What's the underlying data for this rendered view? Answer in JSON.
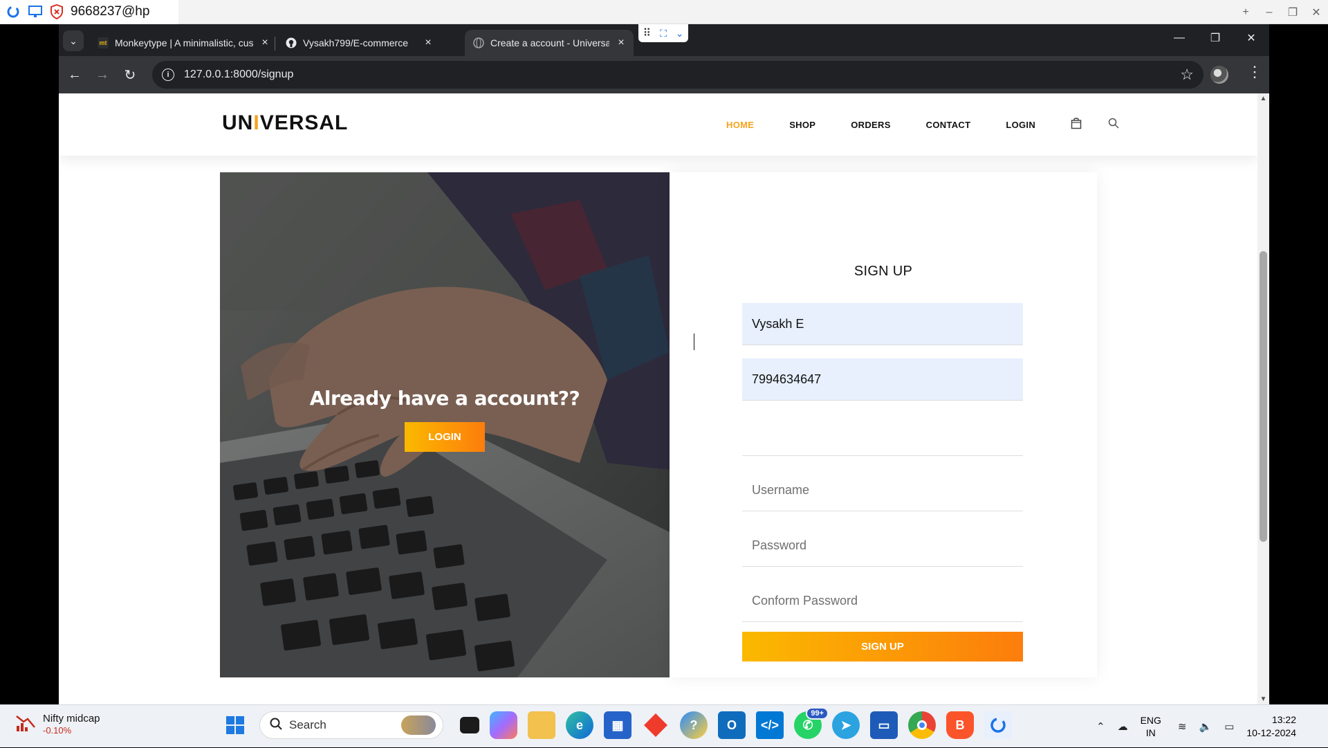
{
  "remote_bar": {
    "title": "9668237@hp"
  },
  "browser": {
    "tabs": [
      {
        "title": "Monkeytype | A minimalistic, customizable typing test",
        "favicon": "mt"
      },
      {
        "title": "Vysakh799/E-commerce",
        "favicon": "github-icon"
      },
      {
        "title": "Create a account - Universal",
        "favicon": "globe-icon"
      }
    ],
    "url": "127.0.0.1:8000/signup"
  },
  "site": {
    "logo": {
      "pre": "UN",
      "accent": "I",
      "post": "VERSAL"
    },
    "nav": [
      {
        "label": "HOME",
        "active": true
      },
      {
        "label": "SHOP",
        "active": false
      },
      {
        "label": "ORDERS",
        "active": false
      },
      {
        "label": "CONTACT",
        "active": false
      },
      {
        "label": "LOGIN",
        "active": false
      }
    ],
    "hero": {
      "heading": "Already have a account??",
      "login_button": "LOGIN"
    },
    "form": {
      "title": "SIGN UP",
      "name_value": "Vysakh E",
      "phone_value": "7994634647",
      "email_value": "",
      "username_placeholder": "Username",
      "password_placeholder": "Password",
      "confirm_placeholder": "Conform Password",
      "submit_label": "SIGN UP"
    },
    "accent_color": "#f7a21b"
  },
  "taskbar": {
    "widget": {
      "title": "Nifty midcap",
      "value": "-0.10%"
    },
    "search_label": "Search",
    "whatsapp_badge": "99+",
    "lang": {
      "line1": "ENG",
      "line2": "IN"
    },
    "clock": {
      "time": "13:22",
      "date": "10-12-2024"
    }
  }
}
